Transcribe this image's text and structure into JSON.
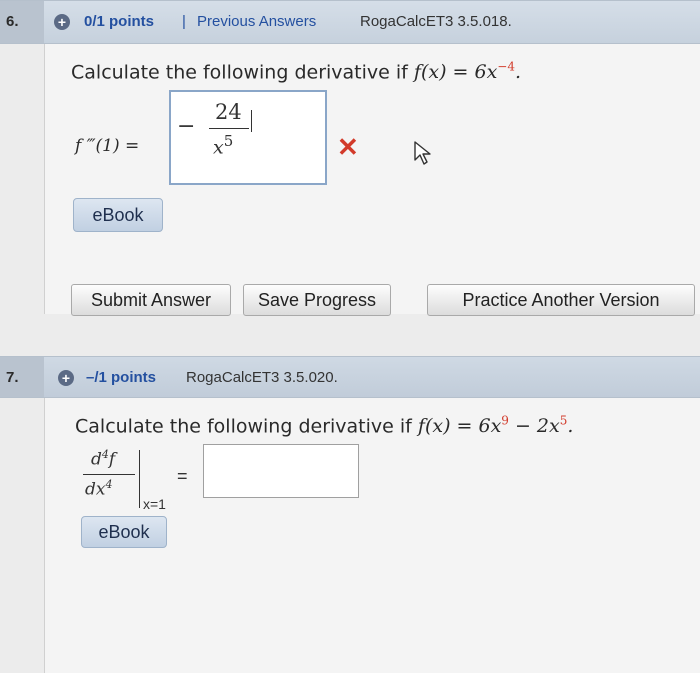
{
  "q1": {
    "number": "6.",
    "points": "0/1 points",
    "separator": "|",
    "previous_answers": "Previous Answers",
    "source": "RogaCalcET3 3.5.018.",
    "prompt_text": "Calculate the following derivative if",
    "function_lhs": "f(x) = 6x",
    "function_exp": "−4",
    "function_end": ".",
    "answer_label": "f ‴(1) =",
    "answer_minus": "−",
    "answer_numerator": "24",
    "answer_denominator_base": "x",
    "answer_denominator_exp": "5",
    "result": "incorrect",
    "ebook_label": "eBook"
  },
  "buttons": {
    "submit": "Submit Answer",
    "save": "Save Progress",
    "practice": "Practice Another Version"
  },
  "q2": {
    "number": "7.",
    "points": "–/1 points",
    "source": "RogaCalcET3 3.5.020.",
    "prompt_text": "Calculate the following derivative if",
    "function_a": "f(x) = 6x",
    "exp_a": "9",
    "function_b": " − 2x",
    "exp_b": "5",
    "function_end": ".",
    "deriv_num": "d",
    "deriv_num_exp": "4",
    "deriv_num_f": "f",
    "deriv_den": "dx",
    "deriv_den_exp": "4",
    "eval_at": "x=1",
    "equals": "=",
    "answer_value": "",
    "ebook_label": "eBook"
  },
  "colors": {
    "header_bg": "#c6d1dd",
    "link": "#2450a0",
    "incorrect": "#d23a2a"
  }
}
